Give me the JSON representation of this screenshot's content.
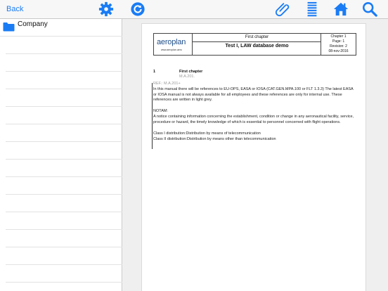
{
  "toolbar": {
    "back_label": "Back",
    "icons": [
      "settings-icon",
      "sync-icon",
      "attachment-icon",
      "list-icon",
      "home-icon",
      "search-icon"
    ],
    "accent": "#1a7cf5"
  },
  "sidebar": {
    "items": [
      {
        "label": "Company",
        "icon": "folder-icon"
      }
    ]
  },
  "document": {
    "header": {
      "logo_text": "aeroplan",
      "logo_url": "www.aeroplan.aero",
      "section": "First chapter",
      "title": "Test I, LAW database demo",
      "chapter": "Chapter 1",
      "page": "Page: 1",
      "revision": "Revision: 2",
      "date": "08-nov-2016"
    },
    "section_number": "1",
    "section_title": "First chapter",
    "section_ref": "M.A.201.",
    "ref_line": "REF.: M.A.201+",
    "paragraph1": "In this manual there will be references to EU-OPS, EASA or IOSA (CAT.GEN.MPA.100 or FLT 1.3.3) The latest EASA or IOSA manual is not always available for all employees and these references are only for internal use. These references are written in light grey.",
    "notam_heading": "NOTAM:",
    "notam_text": "A notice containing information concerning the establishment, condition or change in any aeronautical facility, service, procedure or hazard, the timely knowledge of which is essential to personnel concerned with flight operations.",
    "class1": "Class I distribution:Distribution by means of telecommunication",
    "class2": "Class II distribution:Distribution by means other than telecommunication"
  }
}
